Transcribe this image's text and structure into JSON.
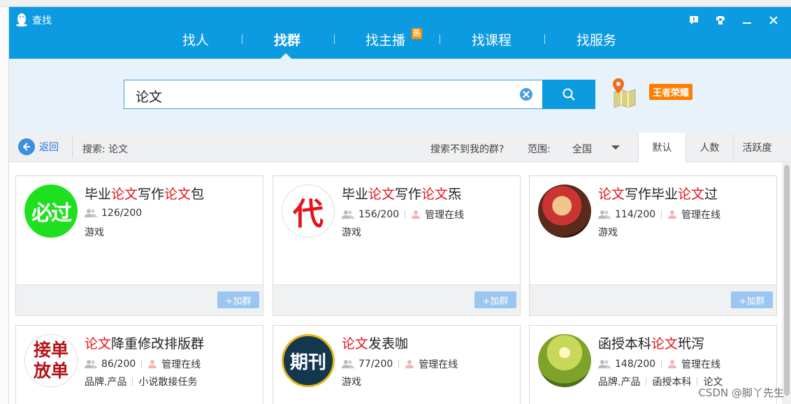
{
  "window": {
    "title": "查找"
  },
  "nav": {
    "items": [
      {
        "label": "找人"
      },
      {
        "label": "找群"
      },
      {
        "label": "找主播",
        "badge": "热"
      },
      {
        "label": "找课程"
      },
      {
        "label": "找服务"
      }
    ]
  },
  "search": {
    "value": "论文",
    "game_badge": "王者荣耀"
  },
  "filter": {
    "back_label": "返回",
    "search_label": "搜索: 论文",
    "notfound_label": "搜索不到我的群?",
    "range_label": "范围:",
    "range_value": "全国",
    "sort_tabs": [
      "默认",
      "人数",
      "活跃度"
    ]
  },
  "cards": [
    {
      "title_parts": [
        "毕业",
        "论文",
        "写作",
        "论文",
        "包"
      ],
      "members": "126/200",
      "manager": "",
      "tags": [
        "游戏"
      ],
      "join_label": "+加群"
    },
    {
      "title_parts": [
        "毕业",
        "论文",
        "写作",
        "论文",
        "炁"
      ],
      "members": "156/200",
      "manager": "管理在线",
      "tags": [
        "游戏"
      ],
      "join_label": "+加群"
    },
    {
      "title_parts": [
        "",
        "论文",
        "写作毕业",
        "论文",
        "过"
      ],
      "members": "114/200",
      "manager": "管理在线",
      "tags": [
        "游戏"
      ],
      "join_label": "+加群"
    },
    {
      "title_parts": [
        "",
        "论文",
        "降重修改排版群",
        "",
        ""
      ],
      "members": "86/200",
      "manager": "管理在线",
      "tags": [
        "品牌.产品",
        "小说散接任务"
      ],
      "join_label": "+加群"
    },
    {
      "title_parts": [
        "",
        "论文",
        "发表咖",
        "",
        ""
      ],
      "members": "77/200",
      "manager": "管理在线",
      "tags": [
        "游戏"
      ],
      "join_label": "+加群"
    },
    {
      "title_parts": [
        "函授本科",
        "论文",
        "玳泻",
        "",
        ""
      ],
      "members": "148/200",
      "manager": "管理在线",
      "tags": [
        "品牌.产品",
        "函授本科",
        "论文"
      ],
      "join_label": "+加群"
    }
  ],
  "avatars": {
    "card0": "必过",
    "card1": "代",
    "card3": [
      "接单",
      "放单"
    ],
    "card4": "期刊"
  },
  "watermark": "CSDN @脚丫先生",
  "colors": {
    "brand": "#0c9ae0",
    "highlight": "#e3141b",
    "hot": "#ff8a00"
  }
}
